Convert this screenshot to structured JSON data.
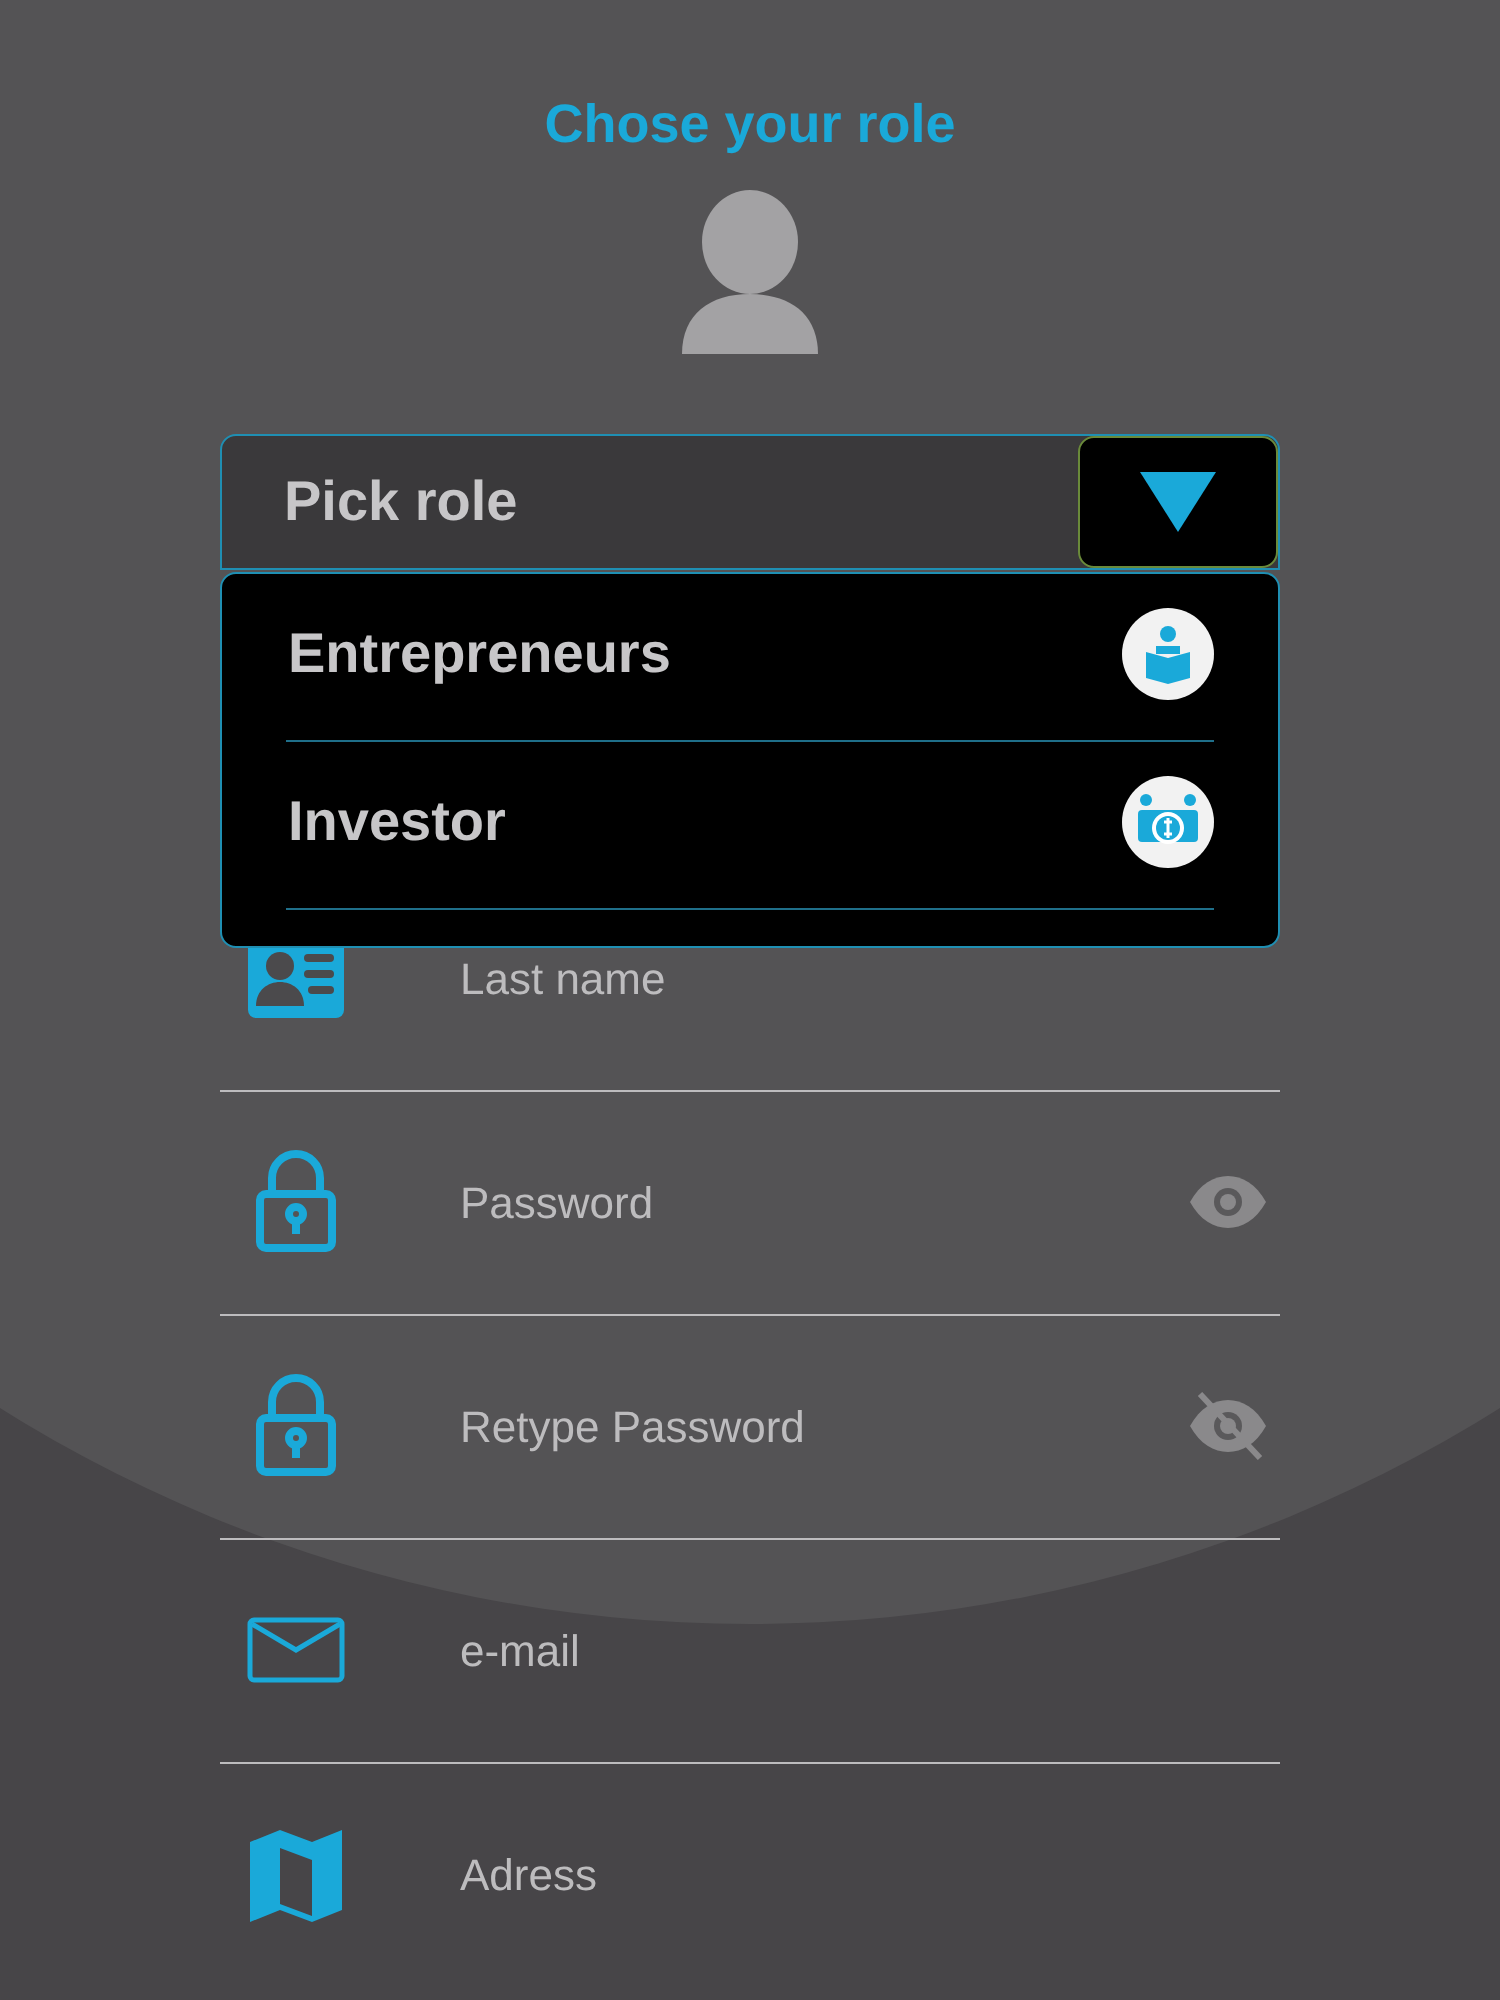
{
  "title": "Chose your role",
  "role_select": {
    "placeholder": "Pick role",
    "expanded": true,
    "options": [
      {
        "label": "Entrepreneurs",
        "kind": "reader"
      },
      {
        "label": "Investor",
        "kind": "money"
      }
    ]
  },
  "fields": [
    {
      "placeholder": "Last name",
      "kind": "id-card"
    },
    {
      "placeholder": "Password",
      "kind": "lock",
      "revealed": true
    },
    {
      "placeholder": "Retype Password",
      "kind": "lock",
      "revealed": false
    },
    {
      "placeholder": "e-mail",
      "kind": "mail"
    },
    {
      "placeholder": "Adress",
      "kind": "map"
    }
  ]
}
